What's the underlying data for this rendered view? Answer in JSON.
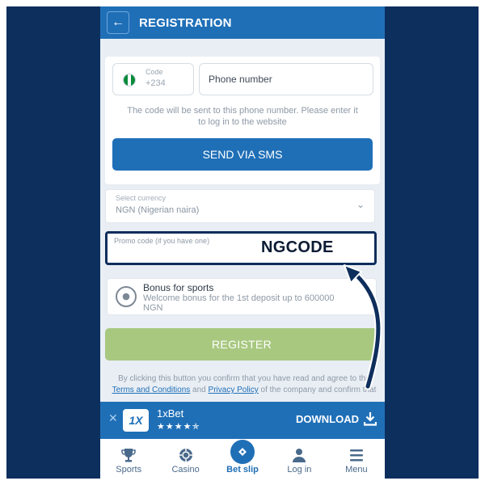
{
  "header": {
    "title": "REGISTRATION"
  },
  "phone_form": {
    "code_label": "Code",
    "code_value": "+234",
    "phone_placeholder": "Phone number",
    "hint_line1": "The code will be sent to this phone number. Please enter it",
    "hint_line2": "to log in to the website",
    "send_button": "SEND VIA SMS"
  },
  "currency": {
    "label": "Select currency",
    "value": "NGN  (Nigerian naira)"
  },
  "promo": {
    "label": "Promo code (if you have one)",
    "value": "NGCODE"
  },
  "bonus": {
    "title": "Bonus for sports",
    "description": "Welcome bonus for the 1st deposit up to 600000 NGN"
  },
  "register_button": "REGISTER",
  "legal": {
    "line1": "By clicking this button you confirm that you have read and agree to the",
    "terms_link": "Terms and Conditions",
    "and": " and ",
    "privacy_link": "Privacy Policy",
    "line2_rest": " of the company and confirm that"
  },
  "banner": {
    "logo": "1X",
    "app_name": "1xBet",
    "rating": 4.5,
    "stars": "★★★★✯",
    "download": "DOWNLOAD"
  },
  "nav": {
    "items": [
      {
        "label": "Sports",
        "icon": "trophy-icon"
      },
      {
        "label": "Casino",
        "icon": "chip-icon"
      },
      {
        "label": "Bet slip",
        "icon": "ticket-icon"
      },
      {
        "label": "Log in",
        "icon": "user-icon"
      },
      {
        "label": "Menu",
        "icon": "menu-icon"
      }
    ]
  },
  "colors": {
    "frame": "#0d2f5e",
    "primary": "#1f6fb7",
    "register": "#a8c880",
    "promo_border": "#0e2e5c"
  }
}
